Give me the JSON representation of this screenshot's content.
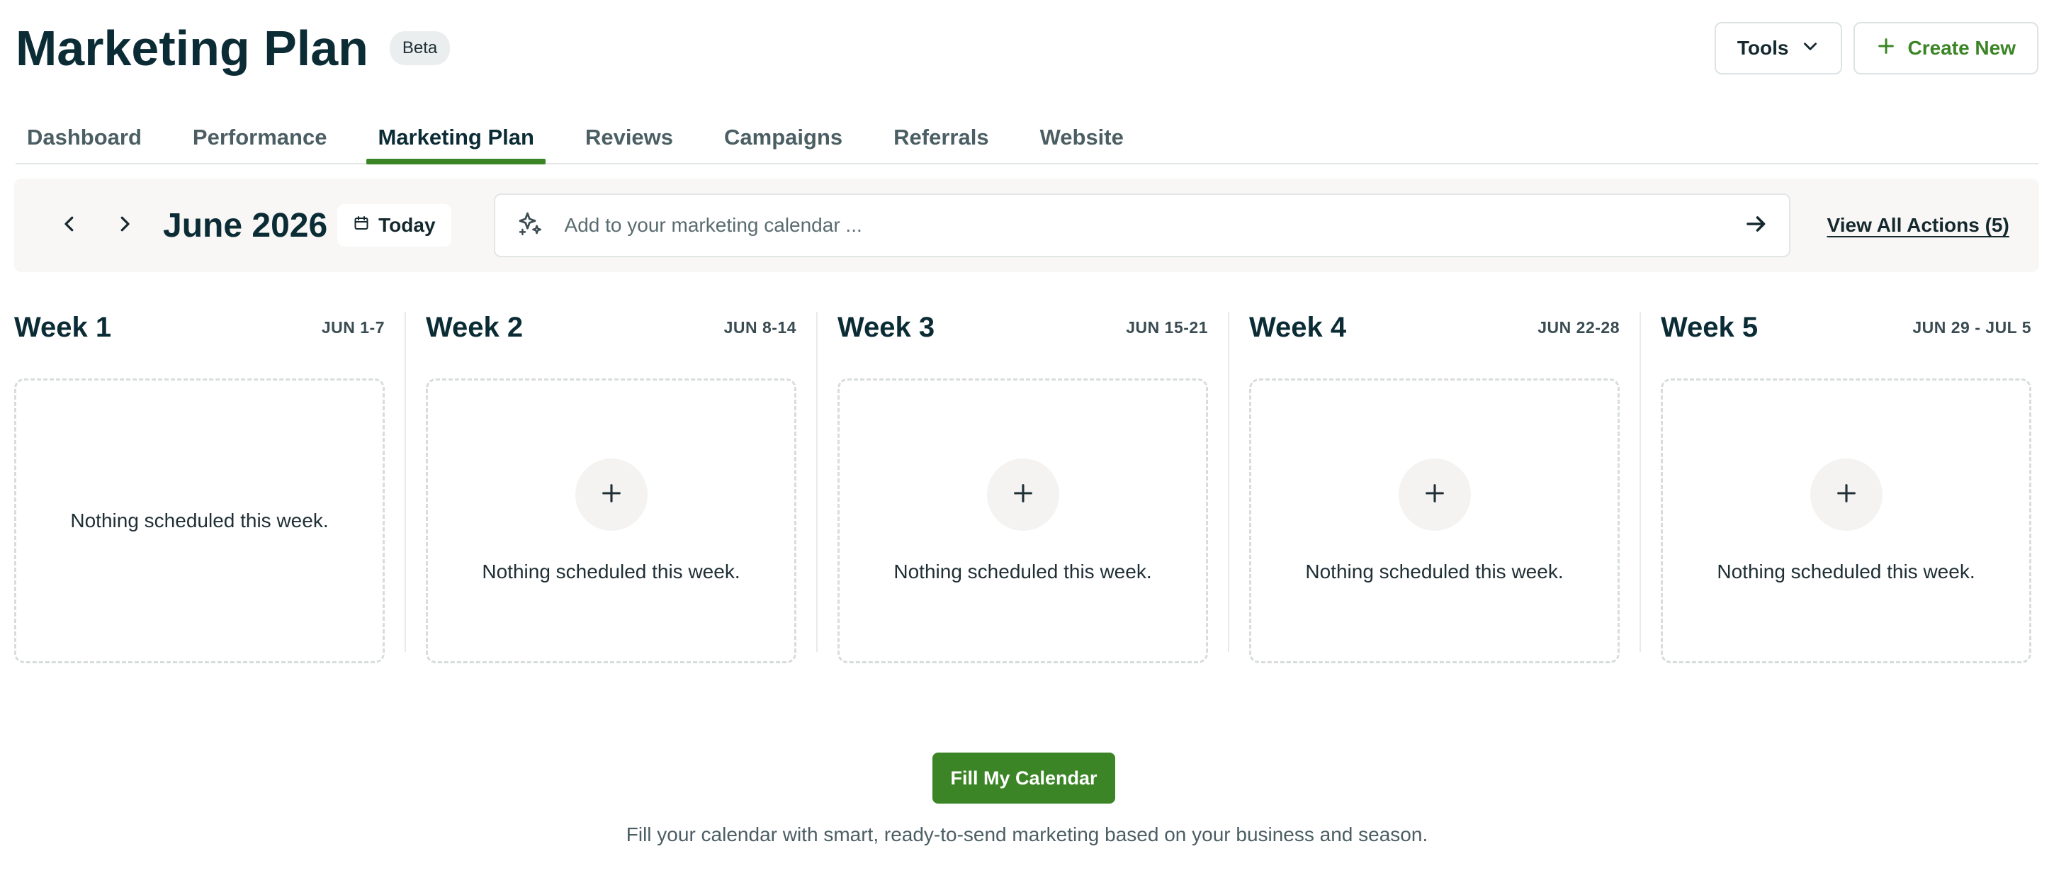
{
  "header": {
    "title": "Marketing Plan",
    "badge": "Beta",
    "tools_label": "Tools",
    "create_label": "Create New"
  },
  "tabs": [
    {
      "label": "Dashboard"
    },
    {
      "label": "Performance"
    },
    {
      "label": "Marketing Plan",
      "active": true
    },
    {
      "label": "Reviews"
    },
    {
      "label": "Campaigns"
    },
    {
      "label": "Referrals"
    },
    {
      "label": "Website"
    }
  ],
  "toolbar": {
    "month": "June 2026",
    "today_label": "Today",
    "input_placeholder": "Add to your marketing calendar ...",
    "view_all_label": "View All Actions (5)"
  },
  "weeks": [
    {
      "title": "Week 1",
      "range": "JUN 1-7",
      "empty_text": "Nothing scheduled this week."
    },
    {
      "title": "Week 2",
      "range": "JUN 8-14",
      "empty_text": "Nothing scheduled this week."
    },
    {
      "title": "Week 3",
      "range": "JUN 15-21",
      "empty_text": "Nothing scheduled this week."
    },
    {
      "title": "Week 4",
      "range": "JUN 22-28",
      "empty_text": "Nothing scheduled this week."
    },
    {
      "title": "Week 5",
      "range": "JUN 29 - JUL 5",
      "empty_text": "Nothing scheduled this week."
    }
  ],
  "fill": {
    "button_label": "Fill My Calendar",
    "description": "Fill your calendar with smart, ready-to-send marketing based on your business and season."
  },
  "colors": {
    "accent": "#3b8526",
    "title": "#0b2c35",
    "toolbar_bg": "#f8f7f5"
  },
  "icons": {
    "tools_chevron": "chevron-down-icon",
    "create": "plus-icon",
    "prev": "chevron-left-icon",
    "next": "chevron-right-icon",
    "today": "calendar-icon",
    "input": "sparkle-icon",
    "submit": "arrow-right-icon",
    "add": "plus-icon"
  }
}
